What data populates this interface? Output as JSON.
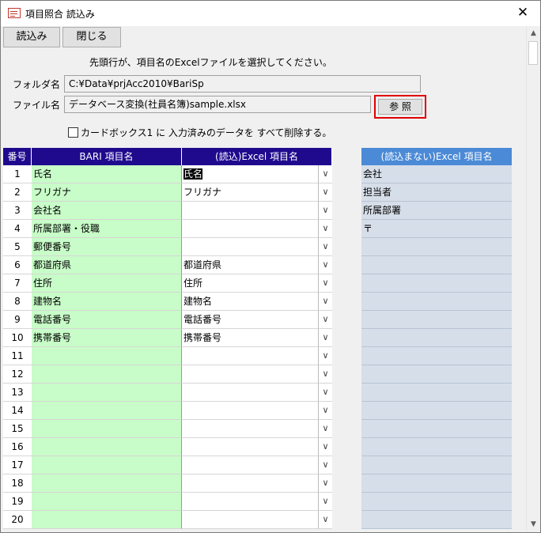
{
  "window": {
    "title": "項目照合 読込み",
    "close": "✕"
  },
  "toolbar": {
    "load_label": "読込み",
    "close_label": "閉じる"
  },
  "instruction": "先頭行が、項目名のExcelファイルを選択してください。",
  "folder": {
    "label": "フォルダ名",
    "value": "C:¥Data¥prjAcc2010¥BariSp"
  },
  "file": {
    "label": "ファイル名",
    "value": "データベース変換(社員名簿)sample.xlsx",
    "browse_label": "参 照"
  },
  "clear_option": {
    "label": "カードボックス1 に 入力済みのデータを すべて削除する。",
    "checked": false
  },
  "grid": {
    "headers": {
      "num": "番号",
      "bari": "BARI 項目名",
      "excel": "(読込)Excel 項目名"
    },
    "rows": [
      {
        "num": "1",
        "bari": "氏名",
        "excel": "氏名"
      },
      {
        "num": "2",
        "bari": "フリガナ",
        "excel": "フリガナ"
      },
      {
        "num": "3",
        "bari": "会社名",
        "excel": ""
      },
      {
        "num": "4",
        "bari": "所属部署・役職",
        "excel": ""
      },
      {
        "num": "5",
        "bari": "郵便番号",
        "excel": ""
      },
      {
        "num": "6",
        "bari": "都道府県",
        "excel": "都道府県"
      },
      {
        "num": "7",
        "bari": "住所",
        "excel": "住所"
      },
      {
        "num": "8",
        "bari": "建物名",
        "excel": "建物名"
      },
      {
        "num": "9",
        "bari": "電話番号",
        "excel": "電話番号"
      },
      {
        "num": "10",
        "bari": "携帯番号",
        "excel": "携帯番号"
      },
      {
        "num": "11",
        "bari": "",
        "excel": ""
      },
      {
        "num": "12",
        "bari": "",
        "excel": ""
      },
      {
        "num": "13",
        "bari": "",
        "excel": ""
      },
      {
        "num": "14",
        "bari": "",
        "excel": ""
      },
      {
        "num": "15",
        "bari": "",
        "excel": ""
      },
      {
        "num": "16",
        "bari": "",
        "excel": ""
      },
      {
        "num": "17",
        "bari": "",
        "excel": ""
      },
      {
        "num": "18",
        "bari": "",
        "excel": ""
      },
      {
        "num": "19",
        "bari": "",
        "excel": ""
      },
      {
        "num": "20",
        "bari": "",
        "excel": ""
      }
    ]
  },
  "unloaded": {
    "header": "(読込まない)Excel 項目名",
    "items": [
      "会社",
      "担当者",
      "所属部署",
      "〒",
      "",
      "",
      "",
      "",
      "",
      "",
      "",
      "",
      "",
      "",
      "",
      "",
      "",
      "",
      "",
      ""
    ]
  }
}
